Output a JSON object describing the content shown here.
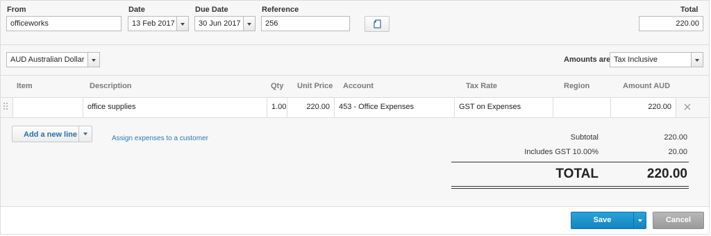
{
  "header": {
    "from_label": "From",
    "from_value": "officeworks",
    "date_label": "Date",
    "date_value": "13 Feb 2017",
    "due_date_label": "Due Date",
    "due_date_value": "30 Jun 2017",
    "reference_label": "Reference",
    "reference_value": "256",
    "total_label": "Total",
    "total_value": "220.00"
  },
  "currency": {
    "selected": "AUD Australian Dollar"
  },
  "amounts": {
    "label": "Amounts are",
    "selected": "Tax Inclusive"
  },
  "table": {
    "columns": [
      "Item",
      "Description",
      "Qty",
      "Unit Price",
      "Account",
      "Tax Rate",
      "Region",
      "Amount AUD"
    ],
    "rows": [
      {
        "item": "",
        "description": "office supplies",
        "qty": "1.00",
        "unit_price": "220.00",
        "account": "453 - Office Expenses",
        "tax_rate": "GST on Expenses",
        "region": "",
        "amount": "220.00"
      }
    ]
  },
  "actions": {
    "add_line_label": "Add a new line",
    "assign_link": "Assign expenses to a customer"
  },
  "totals": {
    "subtotal_label": "Subtotal",
    "subtotal_value": "220.00",
    "gst_label": "Includes GST 10.00%",
    "gst_value": "20.00",
    "total_label": "TOTAL",
    "total_value": "220.00"
  },
  "footer": {
    "save_label": "Save",
    "cancel_label": "Cancel"
  },
  "icons": {
    "copy": "copy-document-icon",
    "dropdown": "chevron-down-icon",
    "remove": "close-icon",
    "drag": "drag-handle-icon"
  },
  "colors": {
    "primary": "#1a8fcf",
    "link": "#2b78b8",
    "cancel": "#a6a6a6"
  }
}
